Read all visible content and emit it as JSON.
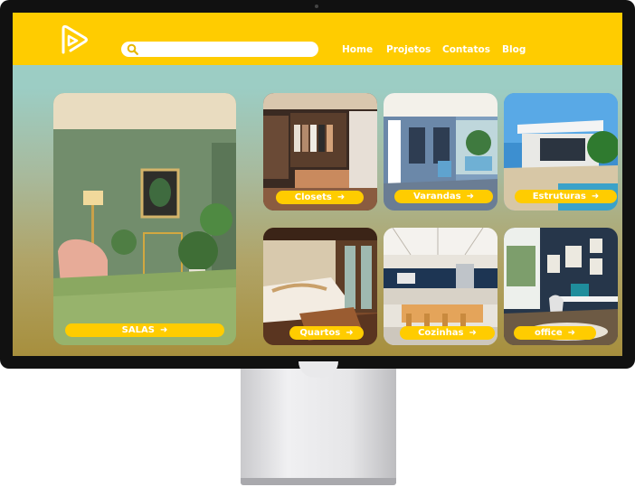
{
  "colors": {
    "accent": "#ffcc00",
    "screen_top": "#9ccdc4",
    "screen_bottom": "#a78f3d",
    "text_on_accent": "#ffffff"
  },
  "header": {
    "logo_icon": "play-logo-icon",
    "search": {
      "icon": "search-icon",
      "placeholder": "",
      "value": ""
    },
    "nav": [
      "Home",
      "Projetos",
      "Contatos",
      "Blog"
    ]
  },
  "cards": [
    {
      "id": "salas",
      "label": "SALAS",
      "icon": "arrow-right-icon"
    },
    {
      "id": "closets",
      "label": "Closets",
      "icon": "arrow-right-icon"
    },
    {
      "id": "varandas",
      "label": "Varandas",
      "icon": "arrow-right-icon"
    },
    {
      "id": "estruturas",
      "label": "Estruturas",
      "icon": "arrow-right-icon"
    },
    {
      "id": "quartos",
      "label": "Quartos",
      "icon": "arrow-right-icon"
    },
    {
      "id": "cozinhas",
      "label": "Cozinhas",
      "icon": "arrow-right-icon"
    },
    {
      "id": "office",
      "label": "office",
      "icon": "arrow-right-icon"
    }
  ],
  "arrow_glyph": "➜"
}
